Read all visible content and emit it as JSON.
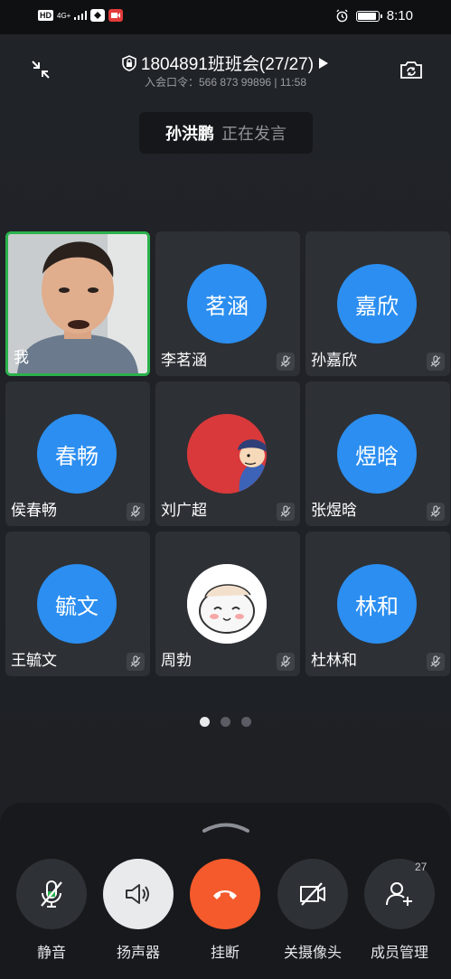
{
  "status_bar": {
    "hd": "HD",
    "network": "4G+",
    "time": "8:10",
    "battery_level": 0.9
  },
  "header": {
    "title": "1804891班班会(27/27)",
    "subtitle": "入会口令：566 873 99896 | 11:58"
  },
  "speaker": {
    "name": "孙洪鹏",
    "status": "正在发言"
  },
  "participants": [
    {
      "name": "我",
      "avatar_text": "",
      "type": "video"
    },
    {
      "name": "李茗涵",
      "avatar_text": "茗涵",
      "type": "initials"
    },
    {
      "name": "孙嘉欣",
      "avatar_text": "嘉欣",
      "type": "initials"
    },
    {
      "name": "侯春畅",
      "avatar_text": "春畅",
      "type": "initials"
    },
    {
      "name": "刘广超",
      "avatar_text": "",
      "type": "picture"
    },
    {
      "name": "张煜晗",
      "avatar_text": "煜晗",
      "type": "initials"
    },
    {
      "name": "王毓文",
      "avatar_text": "毓文",
      "type": "initials"
    },
    {
      "name": "周勃",
      "avatar_text": "",
      "type": "picture"
    },
    {
      "name": "杜林和",
      "avatar_text": "林和",
      "type": "initials"
    }
  ],
  "pagination": {
    "current": 1,
    "total": 3
  },
  "controls": {
    "mute": "静音",
    "speaker": "扬声器",
    "hangup": "挂断",
    "camera_off": "关摄像头",
    "members": "成员管理",
    "member_count": "27"
  },
  "colors": {
    "avatar_blue": "#2b8ef0",
    "hangup_red": "#f55a2c",
    "active_border": "#2bb24c",
    "mute_green": "#2bb24c"
  }
}
